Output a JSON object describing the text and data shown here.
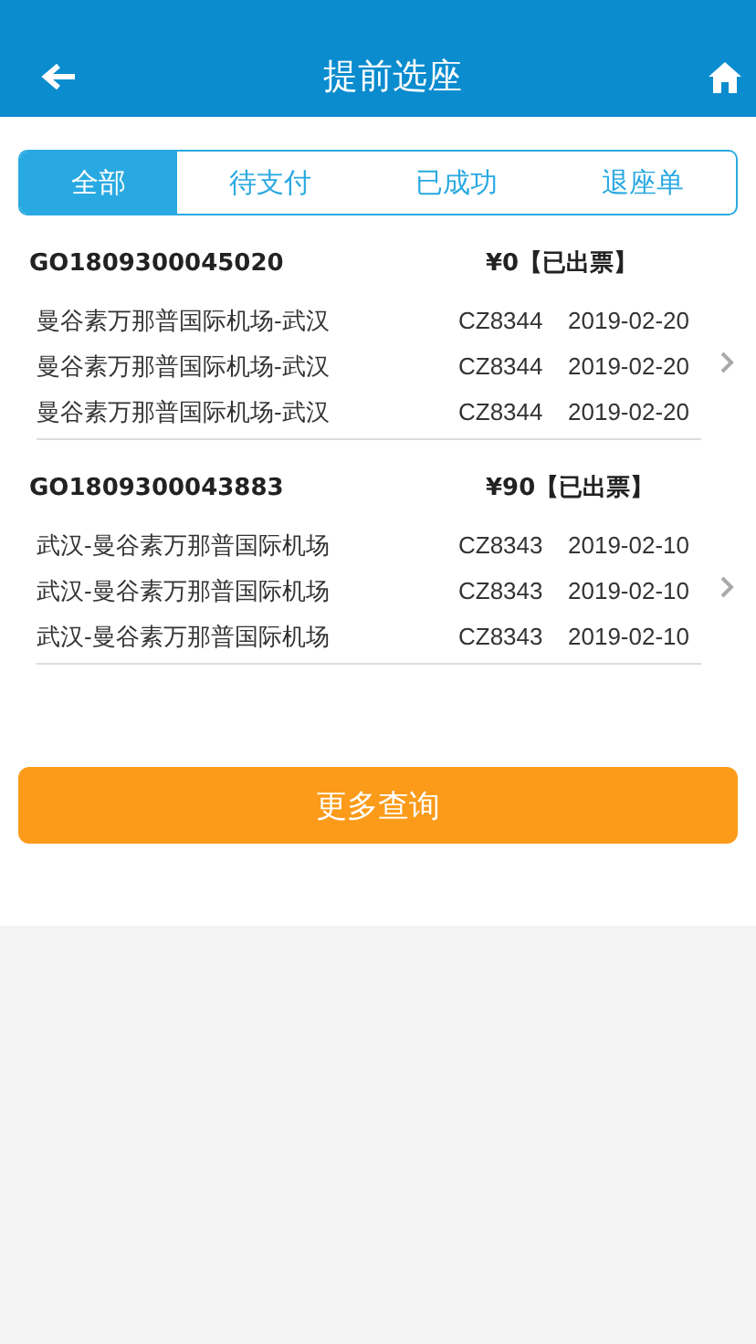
{
  "header": {
    "title": "提前选座"
  },
  "tabs": [
    {
      "label": "全部",
      "selected": true
    },
    {
      "label": "待支付",
      "selected": false
    },
    {
      "label": "已成功",
      "selected": false
    },
    {
      "label": "退座单",
      "selected": false
    }
  ],
  "orders": [
    {
      "order_no": "GO1809300045020",
      "status": "¥0【已出票】",
      "segments": [
        {
          "route": "曼谷素万那普国际机场-武汉",
          "flight": "CZ8344",
          "date": "2019-02-20"
        },
        {
          "route": "曼谷素万那普国际机场-武汉",
          "flight": "CZ8344",
          "date": "2019-02-20"
        },
        {
          "route": "曼谷素万那普国际机场-武汉",
          "flight": "CZ8344",
          "date": "2019-02-20"
        }
      ]
    },
    {
      "order_no": "GO1809300043883",
      "status": "¥90【已出票】",
      "segments": [
        {
          "route": "武汉-曼谷素万那普国际机场",
          "flight": "CZ8343",
          "date": "2019-02-10"
        },
        {
          "route": "武汉-曼谷素万那普国际机场",
          "flight": "CZ8343",
          "date": "2019-02-10"
        },
        {
          "route": "武汉-曼谷素万那普国际机场",
          "flight": "CZ8343",
          "date": "2019-02-10"
        }
      ]
    }
  ],
  "more_button": "更多查询"
}
